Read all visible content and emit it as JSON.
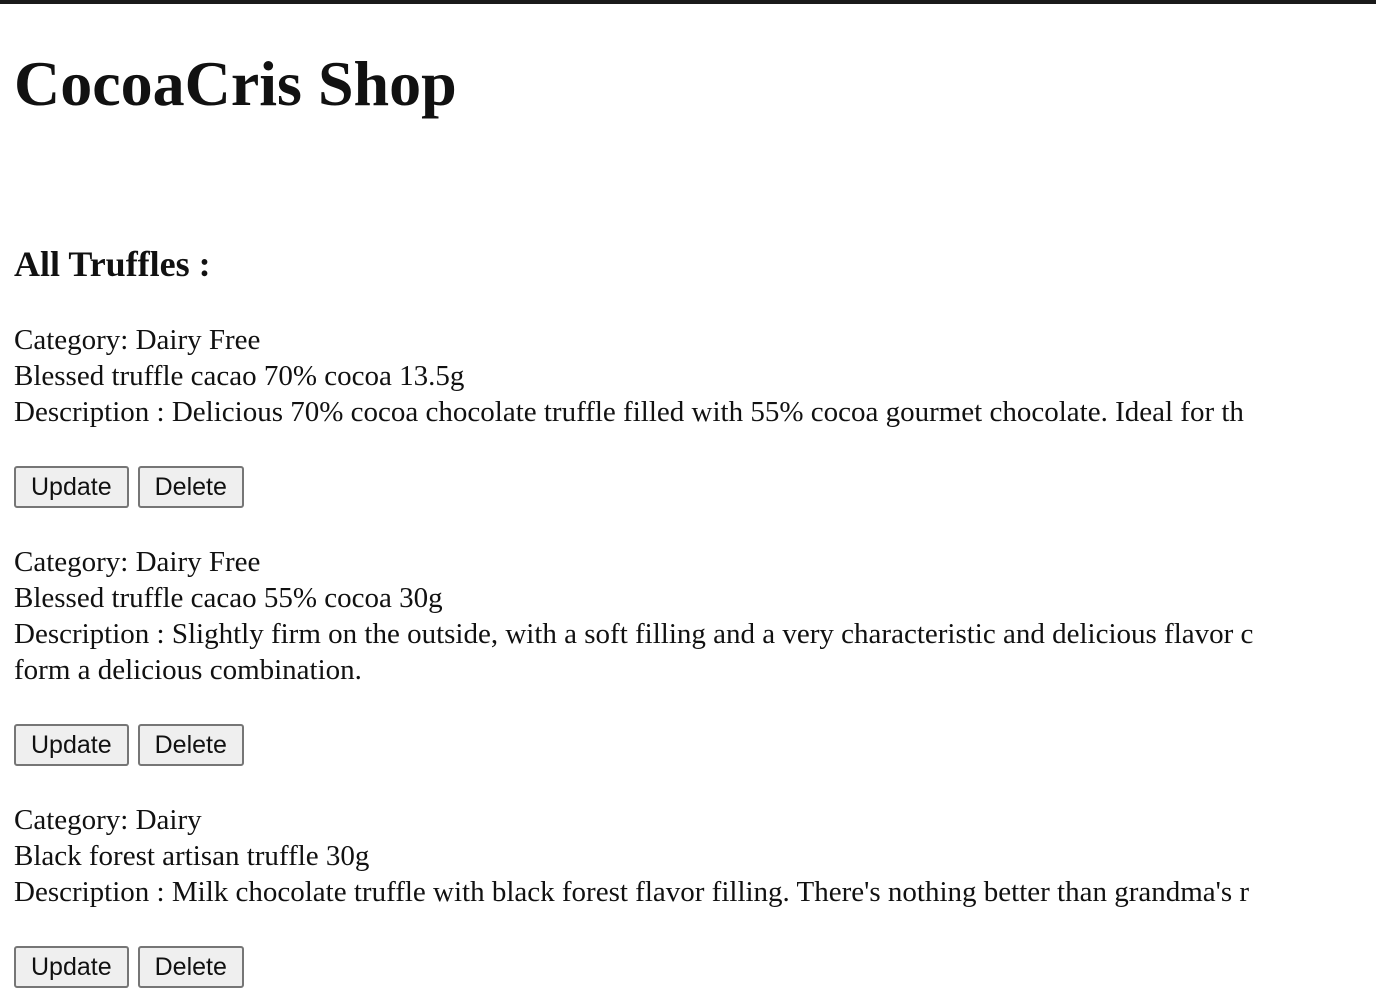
{
  "shop": {
    "title": "CocoaCris Shop"
  },
  "section": {
    "title": "All Truffles :"
  },
  "products": [
    {
      "category": "Category: Dairy Free",
      "name": "Blessed truffle cacao 70% cocoa 13.5g",
      "description": "Description : Delicious 70% cocoa chocolate truffle filled with 55% cocoa gourmet chocolate. Ideal for th",
      "update_label": "Update",
      "delete_label": "Delete"
    },
    {
      "category": "Category: Dairy Free",
      "name": "Blessed truffle cacao 55% cocoa 30g",
      "description": "Description : Slightly firm on the outside, with a soft filling and a very characteristic and delicious flavor c",
      "description_cont": "form a delicious combination.",
      "update_label": "Update",
      "delete_label": "Delete"
    },
    {
      "category": "Category: Dairy",
      "name": "Black forest artisan truffle 30g",
      "description": "Description : Milk chocolate truffle with black forest flavor filling. There's nothing better than grandma's r",
      "update_label": "Update",
      "delete_label": "Delete"
    }
  ]
}
